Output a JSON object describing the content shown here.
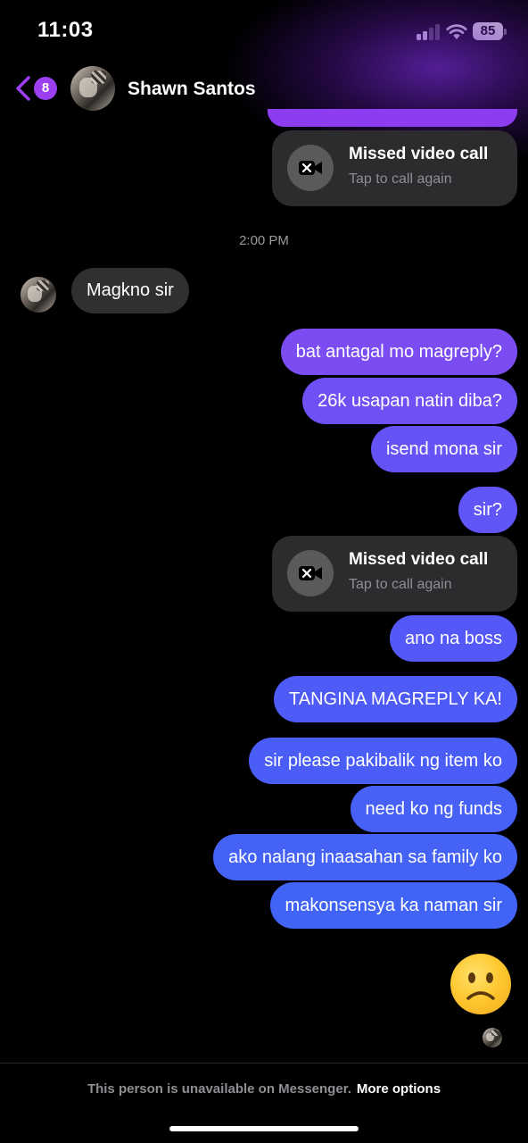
{
  "status_bar": {
    "time": "11:03",
    "battery": "85"
  },
  "header": {
    "badge_count": "8",
    "contact_name": "Shawn Santos"
  },
  "calls": [
    {
      "title": "Missed video call",
      "subtitle": "Tap to call again"
    },
    {
      "title": "Missed video call",
      "subtitle": "Tap to call again"
    }
  ],
  "timestamp": "2:00 PM",
  "incoming": [
    {
      "text": "Magkno sir"
    }
  ],
  "outgoing": [
    {
      "text": "bat antagal mo magreply?"
    },
    {
      "text": "26k usapan natin diba?"
    },
    {
      "text": "isend mona sir"
    },
    {
      "text": "sir?"
    },
    {
      "text": "ano na boss"
    },
    {
      "text": "TANGINA MAGREPLY KA!"
    },
    {
      "text": "sir please pakibalik ng item ko"
    },
    {
      "text": "need ko ng funds"
    },
    {
      "text": "ako nalang inaasahan sa family ko"
    },
    {
      "text": "makonsensya ka naman sir"
    }
  ],
  "reaction": {
    "icon": "frowning-face-emoji"
  },
  "footer": {
    "note": "This person is unavailable on Messenger.",
    "link": "More options"
  },
  "colors": {
    "accent": "#9b3ff0",
    "bubble_incoming": "#303030",
    "call_card": "#2c2c2e"
  }
}
